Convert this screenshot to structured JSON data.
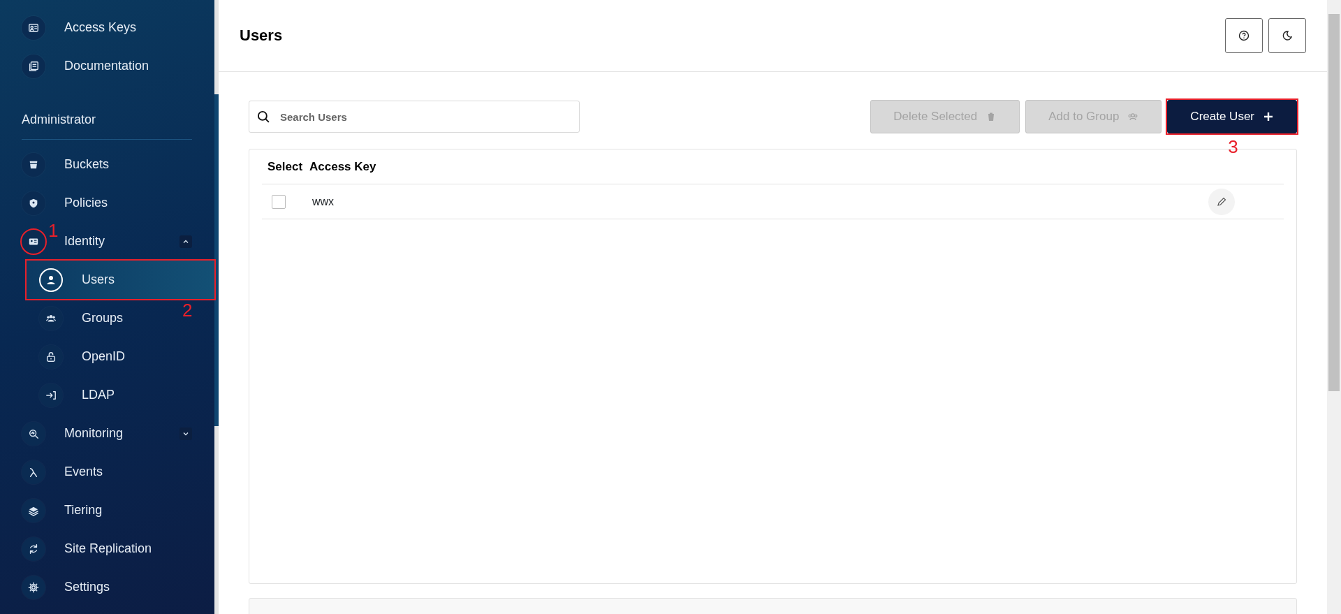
{
  "sidebar": {
    "top_items": [
      {
        "label": "Access Keys"
      },
      {
        "label": "Documentation"
      }
    ],
    "section_title": "Administrator",
    "items": [
      {
        "label": "Buckets",
        "kind": "link"
      },
      {
        "label": "Policies",
        "kind": "link"
      },
      {
        "label": "Identity",
        "kind": "group",
        "expanded": true,
        "children": [
          {
            "label": "Users",
            "selected": true
          },
          {
            "label": "Groups",
            "selected": false
          },
          {
            "label": "OpenID",
            "selected": false
          },
          {
            "label": "LDAP",
            "selected": false
          }
        ]
      },
      {
        "label": "Monitoring",
        "kind": "group",
        "expanded": false
      },
      {
        "label": "Events",
        "kind": "link"
      },
      {
        "label": "Tiering",
        "kind": "link"
      },
      {
        "label": "Site Replication",
        "kind": "link"
      },
      {
        "label": "Settings",
        "kind": "link"
      }
    ]
  },
  "page": {
    "title": "Users"
  },
  "search": {
    "placeholder": "Search Users"
  },
  "actions": [
    {
      "label": "Delete Selected",
      "disabled": true
    },
    {
      "label": "Add to Group",
      "disabled": true
    },
    {
      "label": "Create User",
      "disabled": false
    }
  ],
  "table": {
    "columns": [
      "Select",
      "Access Key"
    ],
    "rows": [
      {
        "access_key": "wwx",
        "checked": false
      }
    ]
  },
  "annotations": [
    {
      "label": "1",
      "kind": "circle"
    },
    {
      "label": "2",
      "kind": "box"
    },
    {
      "label": "3",
      "kind": "box"
    }
  ]
}
